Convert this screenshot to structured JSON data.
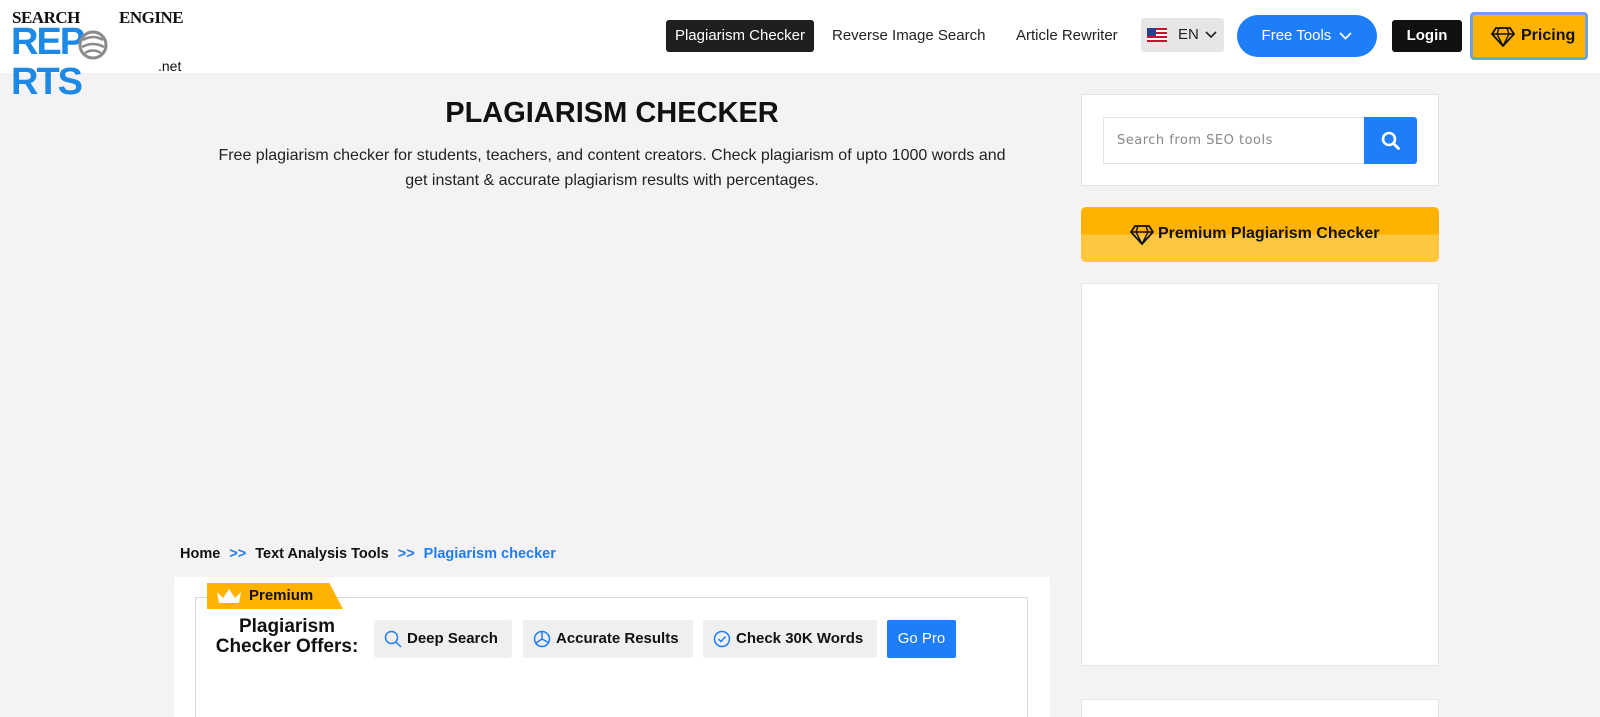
{
  "logo": {
    "line1_left": "SEARCH",
    "line1_right": "ENGINE",
    "line2": "REP RTS",
    "line2_left": "REP",
    "line2_right": "RTS",
    "line3": ".net"
  },
  "nav": {
    "plagiarism_checker": "Plagiarism Checker",
    "reverse_image_search": "Reverse Image Search",
    "article_rewriter": "Article Rewriter",
    "language": "EN",
    "free_tools": "Free Tools",
    "login": "Login",
    "pricing": "Pricing"
  },
  "main": {
    "title": "PLAGIARISM CHECKER",
    "subtitle_line1": "Free plagiarism checker for students, teachers, and content creators. Check plagiarism of upto 1000 words and",
    "subtitle_line2": "get instant & accurate plagiarism results with percentages."
  },
  "breadcrumb": {
    "home": "Home",
    "sep1": ">>",
    "text_analysis": "Text Analysis Tools",
    "sep2": ">>",
    "current": "Plagiarism checker"
  },
  "premium": {
    "ribbon": "Premium",
    "offers_line1": "Plagiarism",
    "offers_line2": "Checker Offers:",
    "deep_search": "Deep Search",
    "accurate_results": "Accurate Results",
    "check_words": "Check 30K Words",
    "go_pro": "Go Pro"
  },
  "sidebar": {
    "search_placeholder": "Search from SEO tools",
    "premium_checker": "Premium Plagiarism Checker"
  },
  "colors": {
    "accent_blue": "#1e7ef7",
    "accent_yellow": "#ffb300",
    "background": "#f4f2f5"
  }
}
